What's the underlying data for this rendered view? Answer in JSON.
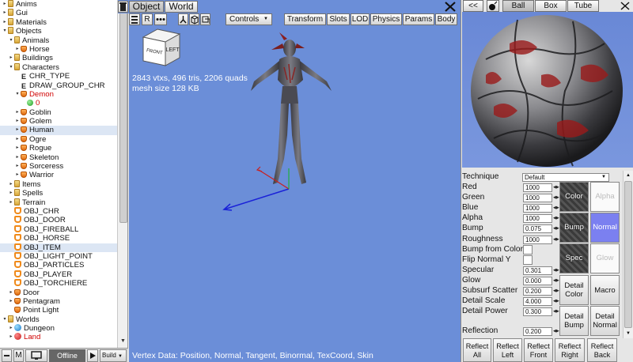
{
  "tree": {
    "rows": [
      {
        "label": "Anims",
        "icon": "folder",
        "indent": 0,
        "arrow": "▸"
      },
      {
        "label": "Gui",
        "icon": "folder",
        "indent": 0,
        "arrow": "▸"
      },
      {
        "label": "Materials",
        "icon": "folder",
        "indent": 0,
        "arrow": "▸"
      },
      {
        "label": "Objects",
        "icon": "folder",
        "indent": 0,
        "arrow": "▾"
      },
      {
        "label": "Animals",
        "icon": "folder",
        "indent": 1,
        "arrow": "▾"
      },
      {
        "label": "Horse",
        "icon": "char",
        "indent": 2,
        "arrow": "▸"
      },
      {
        "label": "Buildings",
        "icon": "folder",
        "indent": 1,
        "arrow": "▸"
      },
      {
        "label": "Characters",
        "icon": "folder",
        "indent": 1,
        "arrow": "▾"
      },
      {
        "label": "CHR_TYPE",
        "icon": "e",
        "indent": 2,
        "arrow": ""
      },
      {
        "label": "DRAW_GROUP_CHR",
        "icon": "e",
        "indent": 2,
        "arrow": ""
      },
      {
        "label": "Demon",
        "icon": "char",
        "indent": 2,
        "arrow": "▾",
        "red": true
      },
      {
        "label": "0",
        "icon": "dot",
        "indent": 3,
        "arrow": "",
        "red": true
      },
      {
        "label": "Goblin",
        "icon": "char",
        "indent": 2,
        "arrow": "▸"
      },
      {
        "label": "Golem",
        "icon": "char",
        "indent": 2,
        "arrow": "▸"
      },
      {
        "label": "Human",
        "icon": "char",
        "indent": 2,
        "arrow": "▸",
        "selected": true
      },
      {
        "label": "Ogre",
        "icon": "char",
        "indent": 2,
        "arrow": "▸"
      },
      {
        "label": "Rogue",
        "icon": "char",
        "indent": 2,
        "arrow": "▸"
      },
      {
        "label": "Skeleton",
        "icon": "char",
        "indent": 2,
        "arrow": "▸"
      },
      {
        "label": "Sorceress",
        "icon": "char",
        "indent": 2,
        "arrow": "▸"
      },
      {
        "label": "Warrior",
        "icon": "char",
        "indent": 2,
        "arrow": "▸"
      },
      {
        "label": "Items",
        "icon": "folder",
        "indent": 1,
        "arrow": "▸"
      },
      {
        "label": "Spells",
        "icon": "folder",
        "indent": 1,
        "arrow": "▸"
      },
      {
        "label": "Terrain",
        "icon": "folder",
        "indent": 1,
        "arrow": "▸"
      },
      {
        "label": "OBJ_CHR",
        "icon": "obj",
        "indent": 1,
        "arrow": ""
      },
      {
        "label": "OBJ_DOOR",
        "icon": "obj",
        "indent": 1,
        "arrow": ""
      },
      {
        "label": "OBJ_FIREBALL",
        "icon": "obj",
        "indent": 1,
        "arrow": ""
      },
      {
        "label": "OBJ_HORSE",
        "icon": "obj",
        "indent": 1,
        "arrow": ""
      },
      {
        "label": "OBJ_ITEM",
        "icon": "obj",
        "indent": 1,
        "arrow": "",
        "selected": true
      },
      {
        "label": "OBJ_LIGHT_POINT",
        "icon": "obj",
        "indent": 1,
        "arrow": ""
      },
      {
        "label": "OBJ_PARTICLES",
        "icon": "obj",
        "indent": 1,
        "arrow": ""
      },
      {
        "label": "OBJ_PLAYER",
        "icon": "obj",
        "indent": 1,
        "arrow": ""
      },
      {
        "label": "OBJ_TORCHIERE",
        "icon": "obj",
        "indent": 1,
        "arrow": ""
      },
      {
        "label": "Door",
        "icon": "char",
        "indent": 1,
        "arrow": "▸"
      },
      {
        "label": "Pentagram",
        "icon": "char",
        "indent": 1,
        "arrow": "▸"
      },
      {
        "label": "Point Light",
        "icon": "char",
        "indent": 1,
        "arrow": ""
      },
      {
        "label": "Worlds",
        "icon": "folder",
        "indent": 0,
        "arrow": "▾"
      },
      {
        "label": "Dungeon",
        "icon": "world",
        "indent": 1,
        "arrow": "▸"
      },
      {
        "label": "Land",
        "icon": "red",
        "indent": 1,
        "arrow": "▸",
        "red": true
      }
    ]
  },
  "bottom_left": {
    "m_label": "M",
    "offline_label": "Offline",
    "build_label": "Build"
  },
  "topbar": {
    "object_tab": "Object",
    "world_tab": "World",
    "r_label": "R",
    "controls_label": "Controls",
    "transform": "Transform",
    "slots": "Slots",
    "lod": "LOD",
    "physics": "Physics",
    "params": "Params",
    "body": "Body"
  },
  "viewport": {
    "stats_line1": "2843 vtxs, 496 tris, 2206 quads",
    "stats_line2": "mesh size 128 KB",
    "cube_front": "FRONT",
    "cube_left": "LEFT",
    "footer": "Vertex Data: Position, Normal, Tangent, Binormal, TexCoord, Skin"
  },
  "preview": {
    "back_label": "<<",
    "ball": "Ball",
    "box": "Box",
    "tube": "Tube"
  },
  "properties": {
    "technique_label": "Technique",
    "technique_value": "Default",
    "rows": [
      {
        "label": "Red",
        "value": "1000"
      },
      {
        "label": "Green",
        "value": "1000"
      },
      {
        "label": "Blue",
        "value": "1000"
      },
      {
        "label": "Alpha",
        "value": "1000"
      },
      {
        "label": "Bump",
        "value": "0.075"
      },
      {
        "label": "Roughness",
        "value": "1000"
      }
    ],
    "bump_from_color": "Bump from Color",
    "flip_normal_y": "Flip Normal Y",
    "rows2": [
      {
        "label": "Specular",
        "value": "0.301"
      },
      {
        "label": "Glow",
        "value": "0.000"
      },
      {
        "label": "Subsurf Scatter",
        "value": "0.200"
      },
      {
        "label": "Detail Scale",
        "value": "4.000"
      },
      {
        "label": "Detail Power",
        "value": "0.300"
      }
    ],
    "reflection_label": "Reflection",
    "reflection_value": "0.200"
  },
  "texture_slots": {
    "color": "Color",
    "alpha": "Alpha",
    "bump": "Bump",
    "normal": "Normal",
    "spec": "Spec",
    "glow": "Glow",
    "detail_color": "Detail Color",
    "macro": "Macro",
    "detail_bump": "Detail Bump",
    "detail_normal": "Detail Normal"
  },
  "reflect_buttons": [
    {
      "line1": "Reflect",
      "line2": "All"
    },
    {
      "line1": "Reflect",
      "line2": "Left"
    },
    {
      "line1": "Reflect",
      "line2": "Front"
    },
    {
      "line1": "Reflect",
      "line2": "Right"
    },
    {
      "line1": "Reflect",
      "line2": "Back"
    }
  ],
  "colors": {
    "viewport_bg": "#6b8ed8",
    "selected_row": "#dce6f4",
    "normal_slot": "#7b80f0"
  }
}
